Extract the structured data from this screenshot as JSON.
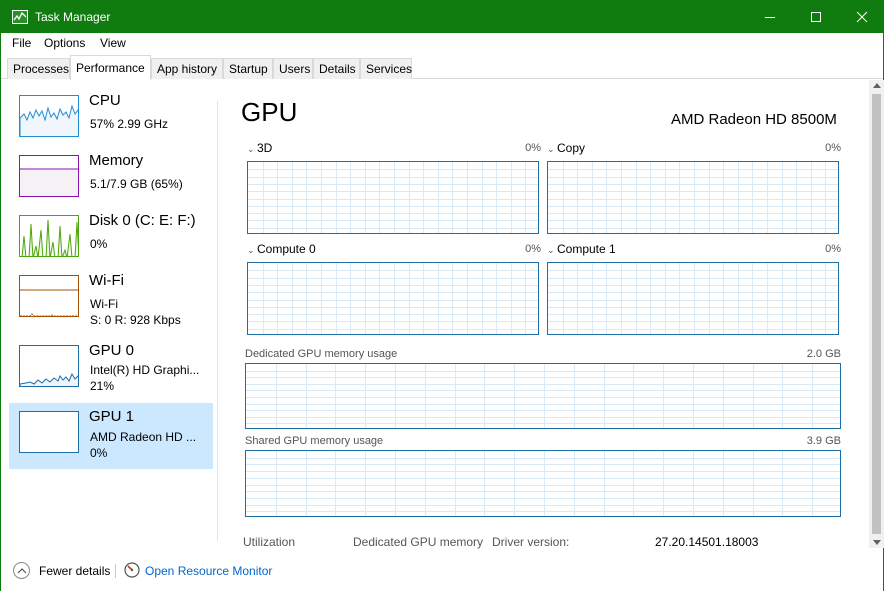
{
  "window": {
    "title": "Task Manager"
  },
  "menu": [
    "File",
    "Options",
    "View"
  ],
  "tabs": [
    "Processes",
    "Performance",
    "App history",
    "Startup",
    "Users",
    "Details",
    "Services"
  ],
  "active_tab": "Performance",
  "sidebar": {
    "items": [
      {
        "name": "CPU",
        "lines": [
          "57% 2.99 GHz"
        ],
        "color": "#1f8dd6"
      },
      {
        "name": "Memory",
        "lines": [
          "5.1/7.9 GB (65%)"
        ],
        "color": "#8b12ae"
      },
      {
        "name": "Disk 0 (C: E: F:)",
        "lines": [
          "0%"
        ],
        "color": "#4da60c"
      },
      {
        "name": "Wi-Fi",
        "lines": [
          "Wi-Fi",
          "S: 0  R: 928 Kbps"
        ],
        "color": "#a74f01"
      },
      {
        "name": "GPU 0",
        "lines": [
          "Intel(R) HD Graphi...",
          "21%"
        ],
        "color": "#1c6ea4"
      },
      {
        "name": "GPU 1",
        "lines": [
          "AMD Radeon HD ...",
          "0%"
        ],
        "color": "#1c6ea4",
        "selected": true
      }
    ]
  },
  "main": {
    "title": "GPU",
    "model": "AMD Radeon HD 8500M",
    "engines": [
      {
        "name": "3D",
        "value": "0%"
      },
      {
        "name": "Copy",
        "value": "0%"
      },
      {
        "name": "Compute 0",
        "value": "0%"
      },
      {
        "name": "Compute 1",
        "value": "0%"
      }
    ],
    "dedicated": {
      "label": "Dedicated GPU memory usage",
      "max": "2.0 GB"
    },
    "shared": {
      "label": "Shared GPU memory usage",
      "max": "3.9 GB"
    },
    "stats": {
      "utilization_label": "Utilization",
      "dedicated_label": "Dedicated GPU memory",
      "driver_label": "Driver version:",
      "driver_value": "27.20.14501.18003"
    }
  },
  "footer": {
    "fewer_details": "Fewer details",
    "open_resource_monitor": "Open Resource Monitor"
  },
  "colors": {
    "titlebar": "#107c10",
    "gpu_graph": "#1c6ea4",
    "selection": "#cce8ff",
    "link": "#0066cc"
  }
}
